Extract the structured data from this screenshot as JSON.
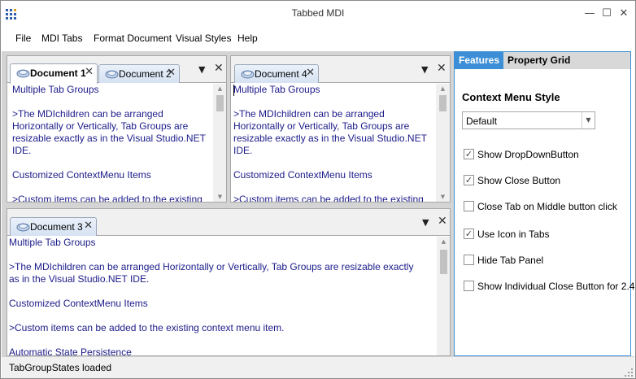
{
  "window": {
    "title": "Tabbed MDI",
    "controls": {
      "minimize": "—",
      "maximize": "☐",
      "close": "✕"
    }
  },
  "menu": [
    "File",
    "MDI Tabs",
    "Format Document",
    "Visual Styles",
    "Help"
  ],
  "tab_groups": [
    {
      "tabs": [
        {
          "label": "Document 1",
          "active": true,
          "icon": "document-icon"
        },
        {
          "label": "Document 2",
          "active": false,
          "icon": "document-icon"
        }
      ],
      "dropdown_glyph": "▼",
      "close_glyph": "✕"
    },
    {
      "tabs": [
        {
          "label": "Document 4",
          "active": false,
          "icon": "document-icon"
        }
      ],
      "dropdown_glyph": "▼",
      "close_glyph": "✕"
    },
    {
      "tabs": [
        {
          "label": "Document 3",
          "active": false,
          "icon": "document-icon"
        }
      ],
      "dropdown_glyph": "▼",
      "close_glyph": "✕"
    }
  ],
  "doc_narrow": [
    "Multiple Tab Groups",
    "",
    ">The MDIchildren can be arranged",
    "Horizontally or Vertically, Tab Groups are",
    "resizable exactly as in the Visual Studio.NET",
    "IDE.",
    "",
    "Customized ContextMenu Items",
    "",
    ">Custom items can be added to the existing"
  ],
  "doc_wide": [
    "Multiple Tab Groups",
    "",
    ">The MDIchildren can be arranged Horizontally or Vertically, Tab Groups are resizable exactly",
    "as in the Visual Studio.NET IDE.",
    "",
    "Customized ContextMenu Items",
    "",
    ">Custom items can be added to the existing context menu item.",
    "",
    "Automatic State Persistence"
  ],
  "side_panel": {
    "tabs": [
      {
        "label": "Features",
        "active": true
      },
      {
        "label": "Property Grid",
        "active": false
      }
    ],
    "heading": "Context Menu Style",
    "combo_value": "Default",
    "options": [
      {
        "label": "Show DropDownButton",
        "checked": true
      },
      {
        "label": "Show Close Button",
        "checked": true
      },
      {
        "label": "Close Tab on Middle button click",
        "checked": false
      },
      {
        "label": "Use Icon in Tabs",
        "checked": true
      },
      {
        "label": "Hide Tab Panel",
        "checked": false
      },
      {
        "label": "Show Individual Close Button for 2.4",
        "checked": false
      }
    ],
    "check_glyph": "✓"
  },
  "status": "TabGroupStates loaded",
  "colors": {
    "accent": "#3c8fd6",
    "doc_text": "#1b1b8a",
    "tab_border": "#9aa6b8"
  }
}
